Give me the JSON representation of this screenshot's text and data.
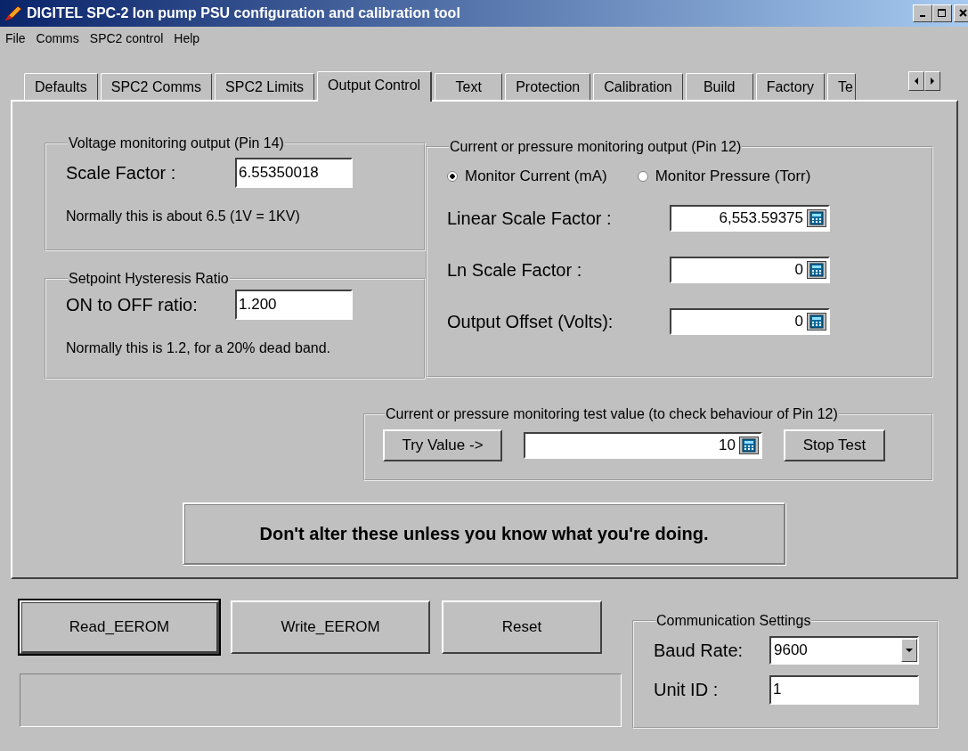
{
  "window": {
    "title": "DIGITEL SPC-2 Ion pump PSU configuration and calibration tool"
  },
  "menu": [
    {
      "label": "File"
    },
    {
      "label": "Comms"
    },
    {
      "label": "SPC2 control"
    },
    {
      "label": "Help"
    }
  ],
  "tabs": [
    {
      "label": "Defaults",
      "selected": false
    },
    {
      "label": "SPC2 Comms",
      "selected": false
    },
    {
      "label": "SPC2 Limits",
      "selected": false
    },
    {
      "label": "Output Control",
      "selected": true
    },
    {
      "label": "Text",
      "selected": false
    },
    {
      "label": "Protection",
      "selected": false
    },
    {
      "label": "Calibration",
      "selected": false
    },
    {
      "label": "Build",
      "selected": false
    },
    {
      "label": "Factory",
      "selected": false
    },
    {
      "label": "Te",
      "selected": false
    }
  ],
  "voltage_group": {
    "title": "Voltage monitoring output (Pin 14)",
    "label": "Scale Factor :",
    "value": "6.55350018",
    "hint": "Normally this is about 6.5   (1V = 1KV)"
  },
  "hysteresis_group": {
    "title": "Setpoint Hysteresis Ratio",
    "label": "ON to OFF ratio:",
    "value": "1.200",
    "hint": "Normally this is 1.2, for a 20% dead band."
  },
  "monitor_group": {
    "title": "Current or pressure monitoring output (Pin 12)",
    "modes": [
      {
        "label": "Monitor Current (mA)",
        "selected": true
      },
      {
        "label": "Monitor Pressure (Torr)",
        "selected": false
      }
    ],
    "fields": [
      {
        "label": "Linear Scale Factor :",
        "value": "6,553.59375"
      },
      {
        "label": "Ln Scale Factor :",
        "value": "0"
      },
      {
        "label": "Output Offset (Volts):",
        "value": "0"
      }
    ]
  },
  "test_group": {
    "title": "Current or pressure monitoring test value (to check behaviour of Pin 12)",
    "try_button": "Try Value ->",
    "value": "10",
    "stop_button": "Stop Test"
  },
  "warning": "Don't alter these unless you know what you're doing.",
  "buttons": [
    {
      "label": "Read_EEROM",
      "focused": true
    },
    {
      "label": "Write_EEROM",
      "focused": false
    },
    {
      "label": "Reset",
      "focused": false
    }
  ],
  "comm_settings": {
    "title": "Communication Settings",
    "baud_label": "Baud Rate:",
    "baud_value": "9600",
    "unit_label": "Unit ID :",
    "unit_value": "1"
  }
}
